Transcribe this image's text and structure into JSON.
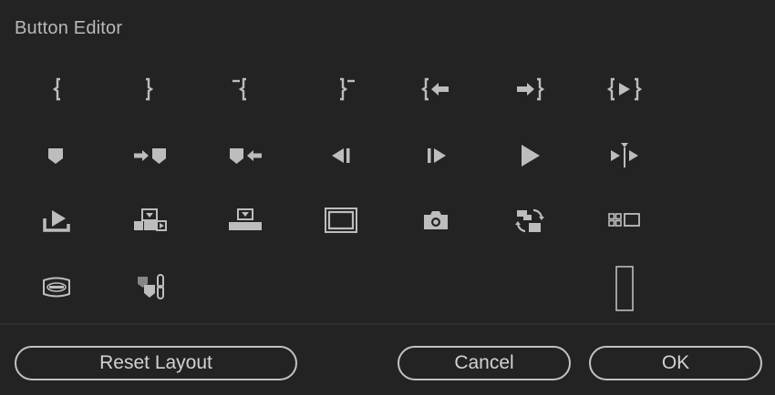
{
  "dialog": {
    "title": "Button Editor"
  },
  "icons": [
    "insert-mark-in-icon",
    "insert-mark-out-icon",
    "clear-in-icon",
    "clear-out-icon",
    "go-to-in-icon",
    "go-to-out-icon",
    "play-in-to-out-icon",
    "add-marker-icon",
    "go-to-next-marker-icon",
    "go-to-previous-marker-icon",
    "step-back-icon",
    "step-forward-icon",
    "play-icon",
    "play-around-icon",
    "export-frame-lift-icon",
    "insert-icon",
    "overwrite-icon",
    "safe-margins-icon",
    "export-frame-camera-icon",
    "toggle-proxies-icon",
    "multi-camera-view-icon",
    "vr-video-icon",
    "marker-link-icon",
    "spacer-icon"
  ],
  "footer": {
    "reset_label": "Reset Layout",
    "cancel_label": "Cancel",
    "ok_label": "OK"
  }
}
